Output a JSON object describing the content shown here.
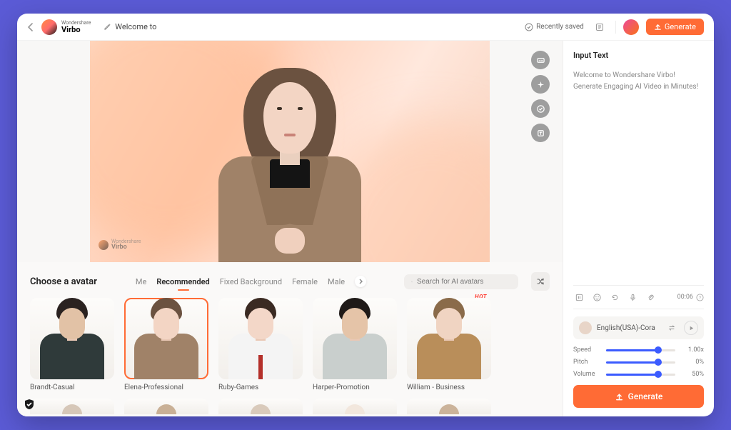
{
  "brand": {
    "name_small": "Wondershare",
    "name": "Virbo"
  },
  "header": {
    "title": "Welcome to",
    "recently_saved": "Recently saved",
    "generate_label": "Generate"
  },
  "float_tools": {
    "captions_icon": "cc",
    "sparkle_icon": "sparkle",
    "checkmark_icon": "check",
    "text_icon": "T"
  },
  "chooser": {
    "title": "Choose a avatar",
    "tabs": [
      "Me",
      "Recommended",
      "Fixed Background",
      "Female",
      "Male"
    ],
    "active_tab_index": 1,
    "search_placeholder": "Search for AI avatars",
    "avatars": [
      {
        "name": "Brandt-Casual",
        "selected": false,
        "hot": false,
        "body": "#2f3a3a",
        "hair": "#2a2220",
        "skin": "#e2c2a6"
      },
      {
        "name": "Elena-Professional",
        "selected": true,
        "hot": false,
        "body": "#a08268",
        "hair": "#6b5240",
        "skin": "#f3d5c4"
      },
      {
        "name": "Ruby-Games",
        "selected": false,
        "hot": false,
        "body": "#f4f4f4",
        "hair": "#3a2a22",
        "skin": "#f3d7c8",
        "extra": "tie"
      },
      {
        "name": "Harper-Promotion",
        "selected": false,
        "hot": false,
        "body": "#c9cfcd",
        "hair": "#1f1a18",
        "skin": "#e5c4a8"
      },
      {
        "name": "William - Business",
        "selected": false,
        "hot": true,
        "body": "#b98e5a",
        "hair": "#8a6b4a",
        "skin": "#f0d4c2"
      }
    ]
  },
  "input_panel": {
    "heading": "Input Text",
    "text": "Welcome to Wondershare Virbo! Generate Engaging AI Video in Minutes!",
    "duration": "00:06",
    "voice": {
      "name": "English(USA)-Cora"
    },
    "sliders": {
      "speed": {
        "label": "Speed",
        "value": "1.00x",
        "percent": 75
      },
      "pitch": {
        "label": "Pitch",
        "value": "0%",
        "percent": 75
      },
      "volume": {
        "label": "Volume",
        "value": "50%",
        "percent": 75
      }
    },
    "generate_label": "Generate"
  }
}
